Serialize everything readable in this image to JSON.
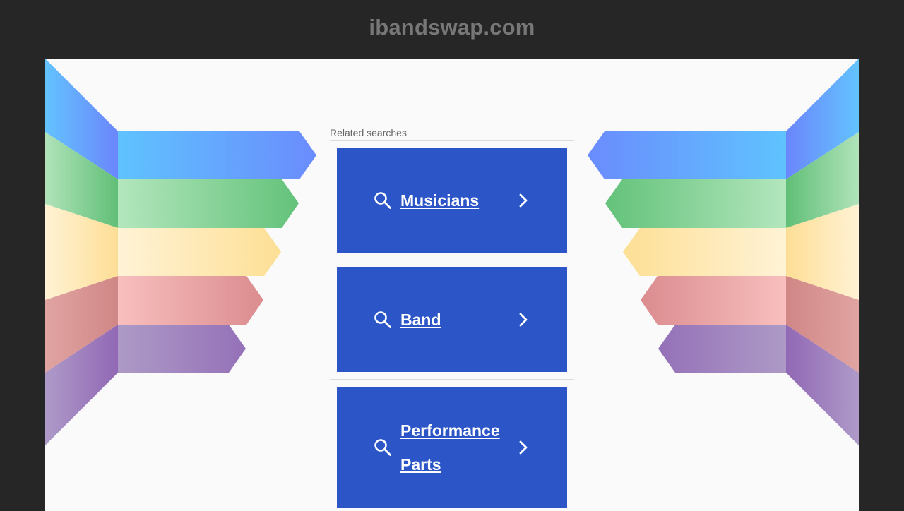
{
  "header": {
    "domain": "ibandswap.com"
  },
  "related": {
    "label": "Related searches",
    "items": [
      {
        "label": "Musicians"
      },
      {
        "label": "Band"
      },
      {
        "label": "Performance Parts"
      }
    ]
  },
  "icons": {
    "search": "search-icon",
    "chevron": "chevron-right-icon"
  },
  "colors": {
    "background": "#262626",
    "panel": "#fafafa",
    "link_box": "#2c56c7",
    "ribbon_blue": "#66c2ff",
    "ribbon_green": "#72c985",
    "ribbon_yellow": "#fde3a0",
    "ribbon_red": "#f6b9b8",
    "ribbon_purple": "#a28bc4"
  }
}
